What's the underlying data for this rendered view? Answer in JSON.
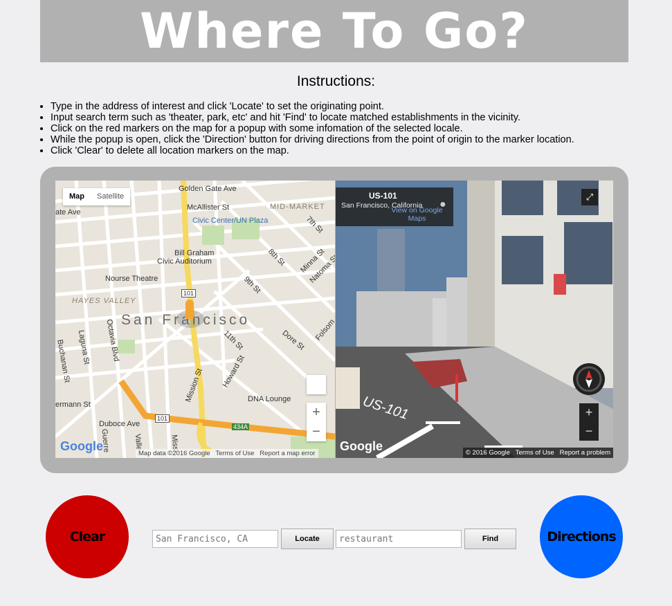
{
  "header": {
    "title": "Where To Go?"
  },
  "instructions": {
    "title": "Instructions:",
    "items": [
      "Type in the address of interest and click 'Locate' to set the originating point.",
      "Input search term such as 'theater, park, etc' and hit 'Find' to locate matched establishments in the vicinity.",
      "Click on the red markers on the map for a popup with some infomation of the selected locale.",
      "While the popup is open, click the 'Direction' button for driving directions from the point of origin to the marker location.",
      "Click 'Clear' to delete all location markers on the map."
    ]
  },
  "map": {
    "type_map": "Map",
    "type_satellite": "Satellite",
    "city_label": "San Francisco",
    "labels": {
      "golden_gate": "Golden Gate Ave",
      "mcallister": "McAllister St",
      "mid_market": "MID-MARKET",
      "civic_center": "Civic Center/UN Plaza",
      "bill_graham": "Bill Graham",
      "civic_auditorium": "Civic Auditorium",
      "nourse": "Nourse Theatre",
      "hayes_valley": "HAYES VALLEY",
      "dna_lounge": "DNA Lounge",
      "duboce": "Duboce Ave",
      "mission": "Mission St",
      "howard": "Howard St",
      "dore": "Dore St",
      "folsom": "Folsom",
      "eleventh": "11th St",
      "ninth": "9th St",
      "eighth": "8th St",
      "seventh": "7th St",
      "minna": "Minna St",
      "natoma": "Natoma St",
      "octavia": "Octavia Blvd",
      "laguna": "Laguna St",
      "buchanan": "Buchanan St",
      "guerrero": "Guerre",
      "valencia": "Valle",
      "missi": "Missi",
      "herman": "ermann St",
      "ate_ave": "ate Ave",
      "hwy101a": "101",
      "hwy101b": "101",
      "hwy434": "434A"
    },
    "zoom_in": "+",
    "zoom_out": "−",
    "logo": "Google",
    "attr_data": "Map data ©2016 Google",
    "attr_terms": "Terms of Use",
    "attr_report": "Report a map error"
  },
  "streetview": {
    "title": "US-101",
    "subtitle": "San Francisco, California",
    "link": "View on Google Maps",
    "road_label": "US-101",
    "logo": "Google",
    "attr_copy": "© 2016 Google",
    "attr_terms": "Terms of Use",
    "attr_report": "Report a problem",
    "zoom_in": "+",
    "zoom_out": "−"
  },
  "controls": {
    "clear_label": "Clear",
    "directions_label": "Directions",
    "locate_value": "San Francisco, CA",
    "locate_button": "Locate",
    "find_value": "restaurant",
    "find_button": "Find"
  },
  "colors": {
    "clear": "#cc0000",
    "directions": "#0064ff",
    "banner": "#b1b1b1",
    "highway": "#f3a534",
    "highway_yellow": "#f6d95e"
  }
}
